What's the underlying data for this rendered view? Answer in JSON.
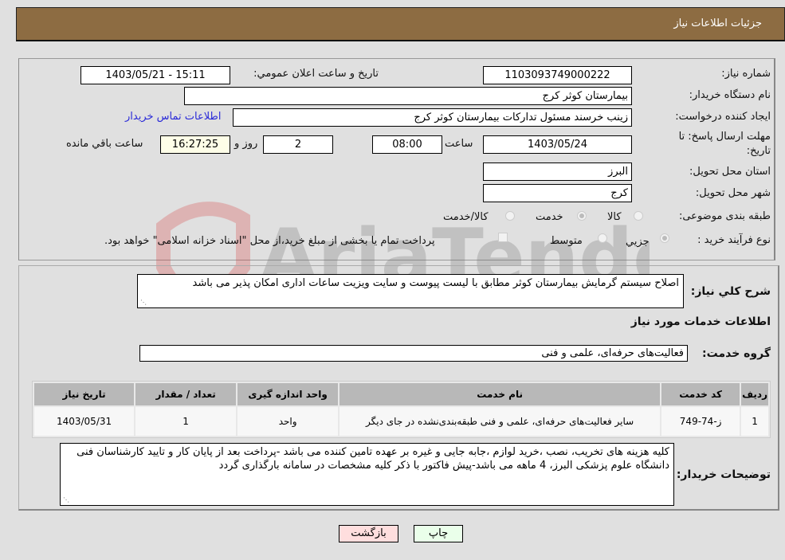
{
  "header": {
    "title": "جزئیات اطلاعات نیاز"
  },
  "form": {
    "need_number": {
      "label": "شماره نیاز:",
      "value": "1103093749000222"
    },
    "announce_datetime": {
      "label": "تاریخ و ساعت اعلان عمومي:",
      "value": "1403/05/21 - 15:11"
    },
    "buyer_org": {
      "label": "نام دستگاه خریدار:",
      "value": "بیمارستان کوثر کرج"
    },
    "requester": {
      "label": "ایجاد کننده درخواست:",
      "value": "زینب خرسند مسئول تداركات بیمارستان کوثر کرج"
    },
    "buyer_contact_link": "اطلاعات تماس خریدار",
    "deadline": {
      "label_line1": "مهلت ارسال پاسخ: تا",
      "label_line2": "تاریخ:",
      "date": "1403/05/24",
      "time_label": "ساعت",
      "time": "08:00",
      "days": "2",
      "days_label": "روز و",
      "remaining": "16:27:25",
      "remaining_label": "ساعت باقي مانده"
    },
    "province": {
      "label": "استان محل تحویل:",
      "value": "البرز"
    },
    "city": {
      "label": "شهر محل تحویل:",
      "value": "کرج"
    },
    "category": {
      "label": "طبقه بندی موضوعی:",
      "options": [
        "کالا",
        "خدمت",
        "کالا/خدمت"
      ],
      "selected": "خدمت"
    },
    "process": {
      "label": "نوع فرآیند خرید :",
      "options": [
        "جزيي",
        "متوسط"
      ],
      "selected": "جزيي",
      "treasury_note": "پرداخت تمام یا بخشی از مبلغ خرید،از محل \"اسناد خزانه اسلامی\" خواهد بود."
    }
  },
  "description": {
    "label": "شرح کلي نیاز:",
    "value": "اصلاح سیستم گرمایش بیمارستان کوثر مطابق با لیست پیوست و سایت ویزیت ساعات اداری امکان پذیر می باشد"
  },
  "services_section": {
    "title": "اطلاعات خدمات مورد نیاز",
    "group_label": "گروه خدمت:",
    "group_value": "فعالیت‌های حرفه‌ای، علمی و فنی"
  },
  "table": {
    "headers": [
      "ردیف",
      "کد خدمت",
      "نام خدمت",
      "واحد اندازه گیری",
      "تعداد / مقدار",
      "تاریخ نیاز"
    ],
    "rows": [
      [
        "1",
        "ز-74-749",
        "سایر فعالیت‌های حرفه‌ای، علمی و فنی طبقه‌بندی‌نشده در جای دیگر",
        "واحد",
        "1",
        "1403/05/31"
      ]
    ]
  },
  "buyer_notes": {
    "label": "توضیحات خریدار:",
    "value": "کلیه هزینه های تخریب، نصب ،خرید لوازم ،جابه جایی و غیره بر عهده تامین کننده می باشد -پرداخت بعد از پایان کار و تایید کارشناسان فنی دانشگاه علوم پزشکی البرز، 4 ماهه می باشد-پیش فاکتور با ذکر کلیه مشخصات در سامانه بارگذاری گردد"
  },
  "buttons": {
    "print": "چاپ",
    "back": "بازگشت"
  },
  "watermark": {
    "text": "AriaTender.neT"
  },
  "colors": {
    "header_bg": "#8d6c42",
    "link": "#2a2ad8",
    "print_bg": "#eaffea",
    "back_bg": "#ffdede",
    "countdown_bg": "#fefee8"
  }
}
